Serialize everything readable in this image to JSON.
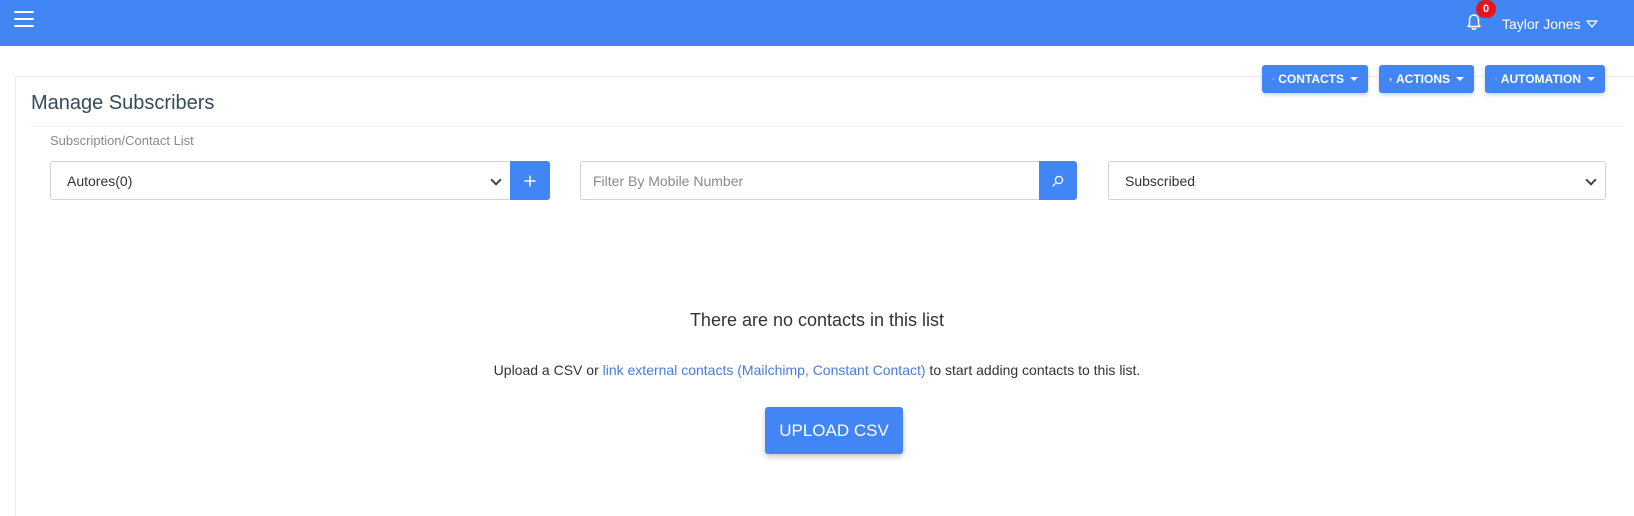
{
  "header": {
    "notification_count": "0",
    "user_name": "Taylor Jones"
  },
  "page": {
    "title": "Manage Subscribers"
  },
  "toolbar": {
    "contacts_label": "CONTACTS",
    "actions_label": "ACTIONS",
    "automation_label": "AUTOMATION"
  },
  "filters": {
    "section_label": "Subscription/Contact List",
    "list_select_value": "Autores(0)",
    "mobile_placeholder": "Filter By Mobile Number",
    "status_select_value": "Subscribed"
  },
  "empty_state": {
    "title": "There are no contacts in this list",
    "desc_prefix": "Upload a CSV or ",
    "desc_link": "link external contacts (Mailchimp, Constant Contact)",
    "desc_suffix": " to start adding contacts to this list.",
    "upload_label": "UPLOAD CSV"
  },
  "colors": {
    "primary": "#4285f4",
    "badge": "#e8151b",
    "link": "#4a7bd8"
  },
  "icons": [
    "hamburger-icon",
    "bell-icon",
    "chevron-down-icon",
    "plus-icon",
    "bolt-icon",
    "gear-icon",
    "search-icon"
  ]
}
